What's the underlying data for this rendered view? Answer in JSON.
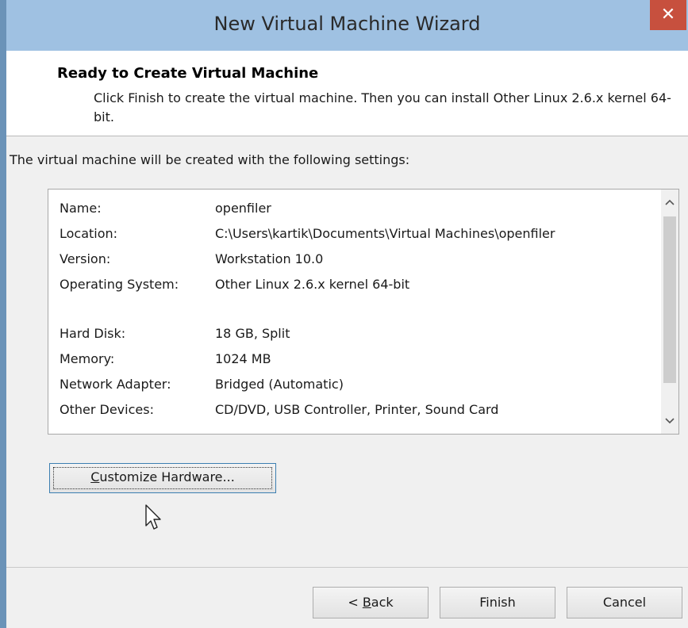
{
  "window": {
    "title": "New Virtual Machine Wizard",
    "close_glyph": "✕"
  },
  "header": {
    "title": "Ready to Create Virtual Machine",
    "description": "Click Finish to create the virtual machine. Then you can install Other Linux 2.6.x kernel 64-bit."
  },
  "intro": "The virtual machine will be created with the following settings:",
  "settings": [
    {
      "label": "Name:",
      "value": "openfiler"
    },
    {
      "label": "Location:",
      "value": "C:\\Users\\kartik\\Documents\\Virtual Machines\\openfiler"
    },
    {
      "label": "Version:",
      "value": "Workstation 10.0"
    },
    {
      "label": "Operating System:",
      "value": "Other Linux 2.6.x kernel 64-bit"
    },
    {
      "label": "Hard Disk:",
      "value": "18 GB, Split"
    },
    {
      "label": "Memory:",
      "value": "1024 MB"
    },
    {
      "label": "Network Adapter:",
      "value": "Bridged (Automatic)"
    },
    {
      "label": "Other Devices:",
      "value": "CD/DVD, USB Controller, Printer, Sound Card"
    }
  ],
  "scroll": {
    "up_glyph": "^",
    "down_glyph": "v"
  },
  "buttons": {
    "customize_mnemonic": "C",
    "customize_rest": "ustomize Hardware...",
    "back_prefix": "< ",
    "back_mnemonic": "B",
    "back_rest": "ack",
    "finish": "Finish",
    "cancel": "Cancel"
  },
  "icons": {
    "close": "close-icon",
    "cursor": "mouse-pointer-icon"
  }
}
